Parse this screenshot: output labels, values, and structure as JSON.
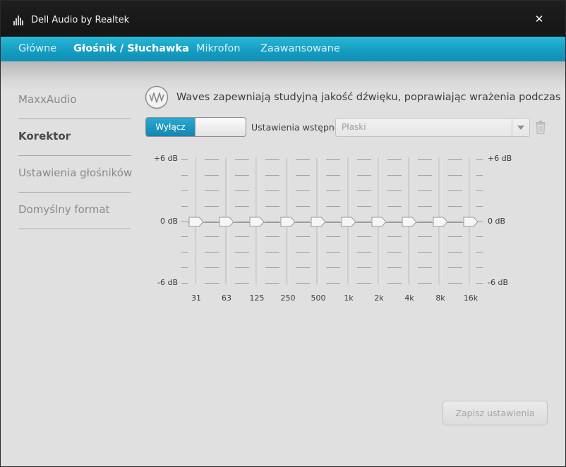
{
  "window": {
    "title": "Dell Audio by Realtek",
    "close_glyph": "✕",
    "icons": [
      "app-audio-icon",
      "close-icon"
    ]
  },
  "tabs": [
    {
      "label": "Główne",
      "active": false
    },
    {
      "label": "Głośnik / Słuchawka",
      "active": true
    },
    {
      "label": "Mikrofon",
      "active": false
    },
    {
      "label": "Zaawansowane",
      "active": false
    }
  ],
  "sidebar": {
    "items": [
      {
        "label": "MaxxAudio",
        "active": false
      },
      {
        "label": "Korektor",
        "active": true
      },
      {
        "label": "Ustawienia głośników",
        "active": false
      },
      {
        "label": "Domyślny format",
        "active": false
      }
    ]
  },
  "main": {
    "description": "Waves zapewniają studyjną jakość dźwięku, poprawiając wrażenia podczas",
    "toggle": {
      "on_label": "Wyłącz"
    },
    "preset": {
      "label": "Ustawienia wstępne",
      "value": "Płaski",
      "icons": [
        "chevron-down-icon",
        "trash-icon"
      ]
    },
    "save_label": "Zapisz ustawienia"
  },
  "equalizer": {
    "left_scale": {
      "top": "+6 dB",
      "mid": "0 dB",
      "bottom": "-6 dB"
    },
    "right_scale": {
      "top": "+6 dB",
      "mid": "0 dB",
      "bottom": "-6 dB"
    },
    "bands": [
      {
        "freq": "31",
        "gain_db": 0
      },
      {
        "freq": "63",
        "gain_db": 0
      },
      {
        "freq": "125",
        "gain_db": 0
      },
      {
        "freq": "250",
        "gain_db": 0
      },
      {
        "freq": "500",
        "gain_db": 0
      },
      {
        "freq": "1k",
        "gain_db": 0
      },
      {
        "freq": "2k",
        "gain_db": 0
      },
      {
        "freq": "4k",
        "gain_db": 0
      },
      {
        "freq": "8k",
        "gain_db": 0
      },
      {
        "freq": "16k",
        "gain_db": 0
      }
    ]
  },
  "colors": {
    "accent": "#159bc0",
    "titlebar": "#1a1a1a",
    "background": "#e0e0e0"
  }
}
